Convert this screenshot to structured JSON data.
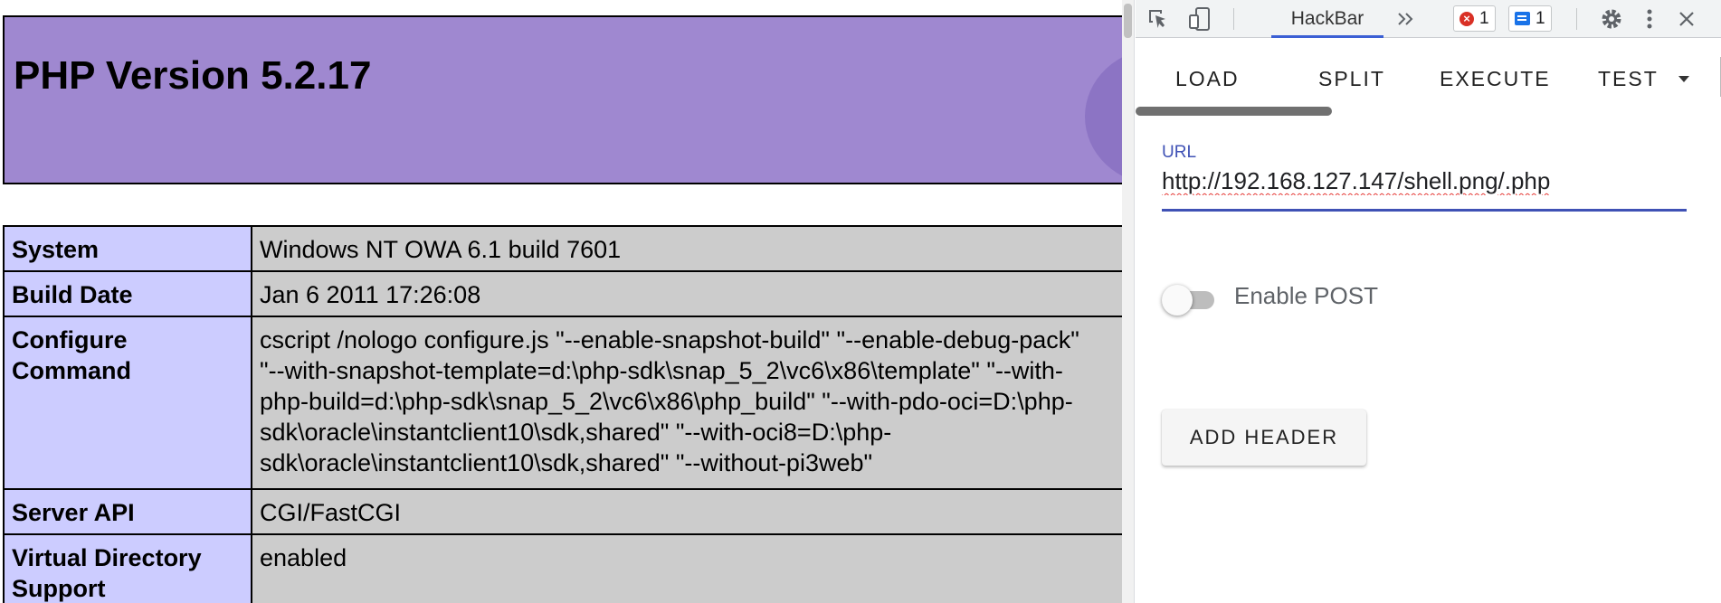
{
  "php_page": {
    "title": "PHP Version 5.2.17",
    "rows": [
      {
        "label": "System",
        "value": "Windows NT OWA 6.1 build 7601"
      },
      {
        "label": "Build Date",
        "value": "Jan 6 2011 17:26:08"
      },
      {
        "label": "Configure Command",
        "value": "cscript /nologo configure.js \"--enable-snapshot-build\" \"--enable-debug-pack\" \"--with-snapshot-template=d:\\php-sdk\\snap_5_2\\vc6\\x86\\template\" \"--with-php-build=d:\\php-sdk\\snap_5_2\\vc6\\x86\\php_build\" \"--with-pdo-oci=D:\\php-sdk\\oracle\\instantclient10\\sdk,shared\" \"--with-oci8=D:\\php-sdk\\oracle\\instantclient10\\sdk,shared\" \"--without-pi3web\""
      },
      {
        "label": "Server API",
        "value": "CGI/FastCGI"
      },
      {
        "label": "Virtual Directory Support",
        "value": "enabled"
      }
    ]
  },
  "devtools": {
    "active_tab": "HackBar",
    "error_count": "1",
    "message_count": "1",
    "icons": {
      "inspect": "inspect-element-icon",
      "device": "device-toolbar-icon",
      "more_tabs": "more-tabs-icon",
      "settings": "gear-icon",
      "menu": "kebab-menu-icon",
      "close": "close-icon"
    }
  },
  "hackbar": {
    "menu": {
      "load": "LOAD",
      "split": "SPLIT",
      "execute": "EXECUTE",
      "test": "TEST"
    },
    "url_label": "URL",
    "url_value": "http://192.168.127.147/shell.png/.php",
    "enable_post_label": "Enable POST",
    "enable_post_on": false,
    "add_header_label": "ADD HEADER"
  },
  "colors": {
    "php_header": "#9f88d0",
    "php_label_cell": "#ccccff",
    "php_value_cell": "#cccccc",
    "accent": "#3f51b5",
    "error": "#d93025",
    "message": "#1a73e8"
  }
}
